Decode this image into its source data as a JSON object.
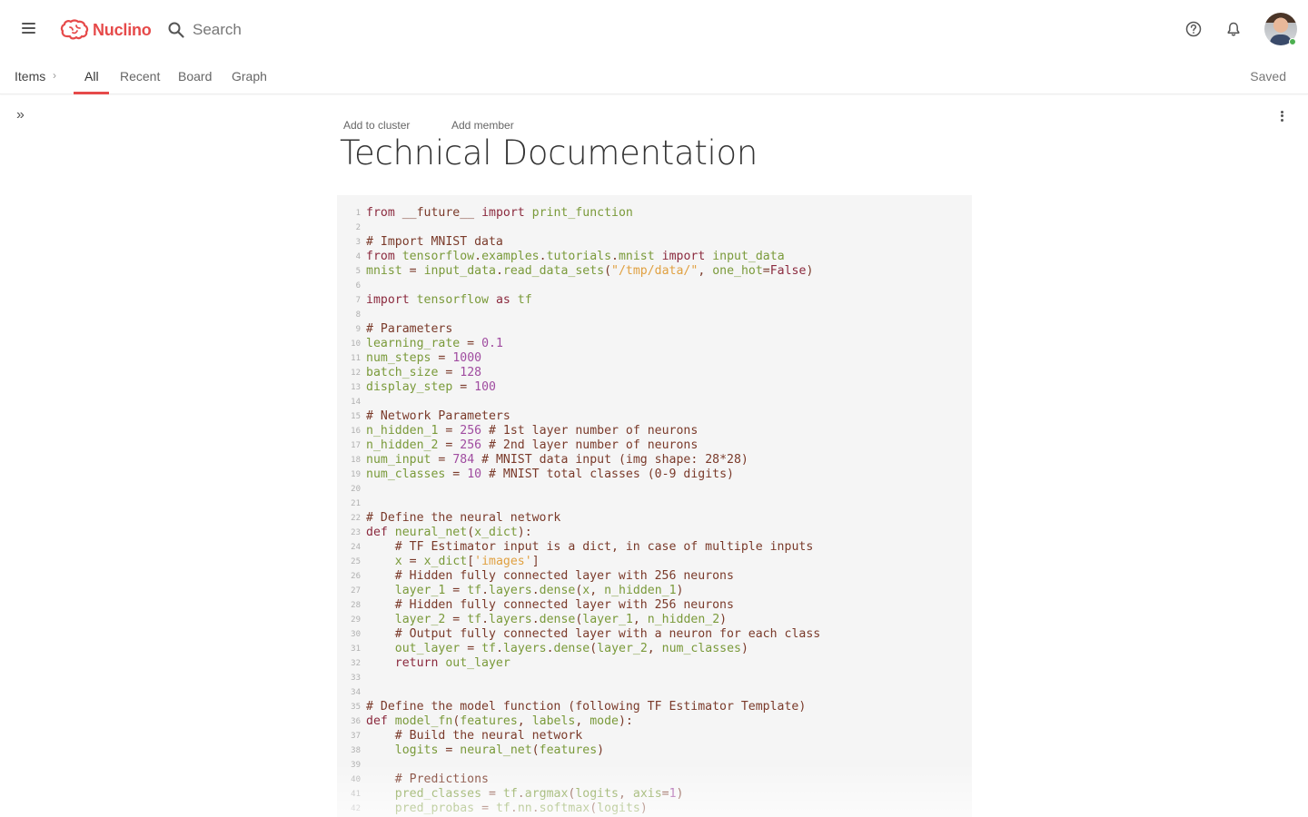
{
  "app": {
    "brand": "Nuclino",
    "brand_color": "#e64a4a"
  },
  "header": {
    "search_placeholder": "Search",
    "help_icon": "help-circle-icon",
    "notifications_icon": "bell-icon"
  },
  "nav": {
    "breadcrumb": "Items",
    "tabs": [
      {
        "label": "All",
        "active": true
      },
      {
        "label": "Recent",
        "active": false
      },
      {
        "label": "Board",
        "active": false
      },
      {
        "label": "Graph",
        "active": false
      }
    ],
    "status": "Saved"
  },
  "document": {
    "add_cluster": "Add to cluster",
    "add_member": "Add member",
    "title": "Technical Documentation"
  },
  "code": {
    "lines": [
      [
        [
          "k",
          "from"
        ],
        [
          "t",
          " "
        ],
        [
          "c",
          "__future__"
        ],
        [
          "t",
          " "
        ],
        [
          "k",
          "import"
        ],
        [
          "t",
          " "
        ],
        [
          "n",
          "print_function"
        ]
      ],
      [],
      [
        [
          "c",
          "# Import MNIST data"
        ]
      ],
      [
        [
          "k",
          "from"
        ],
        [
          "t",
          " "
        ],
        [
          "n",
          "tensorflow"
        ],
        [
          "c",
          "."
        ],
        [
          "n",
          "examples"
        ],
        [
          "c",
          "."
        ],
        [
          "n",
          "tutorials"
        ],
        [
          "c",
          "."
        ],
        [
          "n",
          "mnist"
        ],
        [
          "t",
          " "
        ],
        [
          "k",
          "import"
        ],
        [
          "t",
          " "
        ],
        [
          "n",
          "input_data"
        ]
      ],
      [
        [
          "n",
          "mnist"
        ],
        [
          "t",
          " "
        ],
        [
          "c",
          "="
        ],
        [
          "t",
          " "
        ],
        [
          "n",
          "input_data"
        ],
        [
          "c",
          "."
        ],
        [
          "n",
          "read_data_sets"
        ],
        [
          "c",
          "("
        ],
        [
          "s",
          "\"/tmp/data/\""
        ],
        [
          "c",
          ", "
        ],
        [
          "n",
          "one_hot"
        ],
        [
          "c",
          "="
        ],
        [
          "k",
          "False"
        ],
        [
          "c",
          ")"
        ]
      ],
      [],
      [
        [
          "k",
          "import"
        ],
        [
          "t",
          " "
        ],
        [
          "n",
          "tensorflow"
        ],
        [
          "t",
          " "
        ],
        [
          "k",
          "as"
        ],
        [
          "t",
          " "
        ],
        [
          "n",
          "tf"
        ]
      ],
      [],
      [
        [
          "c",
          "# Parameters"
        ]
      ],
      [
        [
          "n",
          "learning_rate"
        ],
        [
          "t",
          " "
        ],
        [
          "c",
          "="
        ],
        [
          "t",
          " "
        ],
        [
          "m",
          "0.1"
        ]
      ],
      [
        [
          "n",
          "num_steps"
        ],
        [
          "t",
          " "
        ],
        [
          "c",
          "="
        ],
        [
          "t",
          " "
        ],
        [
          "m",
          "1000"
        ]
      ],
      [
        [
          "n",
          "batch_size"
        ],
        [
          "t",
          " "
        ],
        [
          "c",
          "="
        ],
        [
          "t",
          " "
        ],
        [
          "m",
          "128"
        ]
      ],
      [
        [
          "n",
          "display_step"
        ],
        [
          "t",
          " "
        ],
        [
          "c",
          "="
        ],
        [
          "t",
          " "
        ],
        [
          "m",
          "100"
        ]
      ],
      [],
      [
        [
          "c",
          "# Network Parameters"
        ]
      ],
      [
        [
          "n",
          "n_hidden_1"
        ],
        [
          "t",
          " "
        ],
        [
          "c",
          "="
        ],
        [
          "t",
          " "
        ],
        [
          "m",
          "256"
        ],
        [
          "t",
          " "
        ],
        [
          "c",
          "# 1st layer number of neurons"
        ]
      ],
      [
        [
          "n",
          "n_hidden_2"
        ],
        [
          "t",
          " "
        ],
        [
          "c",
          "="
        ],
        [
          "t",
          " "
        ],
        [
          "m",
          "256"
        ],
        [
          "t",
          " "
        ],
        [
          "c",
          "# 2nd layer number of neurons"
        ]
      ],
      [
        [
          "n",
          "num_input"
        ],
        [
          "t",
          " "
        ],
        [
          "c",
          "="
        ],
        [
          "t",
          " "
        ],
        [
          "m",
          "784"
        ],
        [
          "t",
          " "
        ],
        [
          "c",
          "# MNIST data input (img shape: 28*28)"
        ]
      ],
      [
        [
          "n",
          "num_classes"
        ],
        [
          "t",
          " "
        ],
        [
          "c",
          "="
        ],
        [
          "t",
          " "
        ],
        [
          "m",
          "10"
        ],
        [
          "t",
          " "
        ],
        [
          "c",
          "# MNIST total classes (0-9 digits)"
        ]
      ],
      [],
      [],
      [
        [
          "c",
          "# Define the neural network"
        ]
      ],
      [
        [
          "k",
          "def"
        ],
        [
          "t",
          " "
        ],
        [
          "n",
          "neural_net"
        ],
        [
          "c",
          "("
        ],
        [
          "n",
          "x_dict"
        ],
        [
          "c",
          "):"
        ]
      ],
      [
        [
          "t",
          "    "
        ],
        [
          "c",
          "# TF Estimator input is a dict, in case of multiple inputs"
        ]
      ],
      [
        [
          "t",
          "    "
        ],
        [
          "n",
          "x"
        ],
        [
          "t",
          " "
        ],
        [
          "c",
          "="
        ],
        [
          "t",
          " "
        ],
        [
          "n",
          "x_dict"
        ],
        [
          "c",
          "["
        ],
        [
          "s",
          "'images'"
        ],
        [
          "c",
          "]"
        ]
      ],
      [
        [
          "t",
          "    "
        ],
        [
          "c",
          "# Hidden fully connected layer with 256 neurons"
        ]
      ],
      [
        [
          "t",
          "    "
        ],
        [
          "n",
          "layer_1"
        ],
        [
          "t",
          " "
        ],
        [
          "c",
          "="
        ],
        [
          "t",
          " "
        ],
        [
          "n",
          "tf"
        ],
        [
          "c",
          "."
        ],
        [
          "n",
          "layers"
        ],
        [
          "c",
          "."
        ],
        [
          "n",
          "dense"
        ],
        [
          "c",
          "("
        ],
        [
          "n",
          "x"
        ],
        [
          "c",
          ", "
        ],
        [
          "n",
          "n_hidden_1"
        ],
        [
          "c",
          ")"
        ]
      ],
      [
        [
          "t",
          "    "
        ],
        [
          "c",
          "# Hidden fully connected layer with 256 neurons"
        ]
      ],
      [
        [
          "t",
          "    "
        ],
        [
          "n",
          "layer_2"
        ],
        [
          "t",
          " "
        ],
        [
          "c",
          "="
        ],
        [
          "t",
          " "
        ],
        [
          "n",
          "tf"
        ],
        [
          "c",
          "."
        ],
        [
          "n",
          "layers"
        ],
        [
          "c",
          "."
        ],
        [
          "n",
          "dense"
        ],
        [
          "c",
          "("
        ],
        [
          "n",
          "layer_1"
        ],
        [
          "c",
          ", "
        ],
        [
          "n",
          "n_hidden_2"
        ],
        [
          "c",
          ")"
        ]
      ],
      [
        [
          "t",
          "    "
        ],
        [
          "c",
          "# Output fully connected layer with a neuron for each class"
        ]
      ],
      [
        [
          "t",
          "    "
        ],
        [
          "n",
          "out_layer"
        ],
        [
          "t",
          " "
        ],
        [
          "c",
          "="
        ],
        [
          "t",
          " "
        ],
        [
          "n",
          "tf"
        ],
        [
          "c",
          "."
        ],
        [
          "n",
          "layers"
        ],
        [
          "c",
          "."
        ],
        [
          "n",
          "dense"
        ],
        [
          "c",
          "("
        ],
        [
          "n",
          "layer_2"
        ],
        [
          "c",
          ", "
        ],
        [
          "n",
          "num_classes"
        ],
        [
          "c",
          ")"
        ]
      ],
      [
        [
          "t",
          "    "
        ],
        [
          "k",
          "return"
        ],
        [
          "t",
          " "
        ],
        [
          "n",
          "out_layer"
        ]
      ],
      [],
      [],
      [
        [
          "c",
          "# Define the model function (following TF Estimator Template)"
        ]
      ],
      [
        [
          "k",
          "def"
        ],
        [
          "t",
          " "
        ],
        [
          "n",
          "model_fn"
        ],
        [
          "c",
          "("
        ],
        [
          "n",
          "features"
        ],
        [
          "c",
          ", "
        ],
        [
          "n",
          "labels"
        ],
        [
          "c",
          ", "
        ],
        [
          "n",
          "mode"
        ],
        [
          "c",
          "):"
        ]
      ],
      [
        [
          "t",
          "    "
        ],
        [
          "c",
          "# Build the neural network"
        ]
      ],
      [
        [
          "t",
          "    "
        ],
        [
          "n",
          "logits"
        ],
        [
          "t",
          " "
        ],
        [
          "c",
          "="
        ],
        [
          "t",
          " "
        ],
        [
          "n",
          "neural_net"
        ],
        [
          "c",
          "("
        ],
        [
          "n",
          "features"
        ],
        [
          "c",
          ")"
        ]
      ],
      [],
      [
        [
          "t",
          "    "
        ],
        [
          "c",
          "# Predictions"
        ]
      ],
      [
        [
          "t",
          "    "
        ],
        [
          "n",
          "pred_classes"
        ],
        [
          "t",
          " "
        ],
        [
          "c",
          "="
        ],
        [
          "t",
          " "
        ],
        [
          "n",
          "tf"
        ],
        [
          "c",
          "."
        ],
        [
          "n",
          "argmax"
        ],
        [
          "c",
          "("
        ],
        [
          "n",
          "logits"
        ],
        [
          "c",
          ", "
        ],
        [
          "n",
          "axis"
        ],
        [
          "c",
          "="
        ],
        [
          "m",
          "1"
        ],
        [
          "c",
          ")"
        ]
      ],
      [
        [
          "t",
          "    "
        ],
        [
          "n",
          "pred_probas"
        ],
        [
          "t",
          " "
        ],
        [
          "c",
          "="
        ],
        [
          "t",
          " "
        ],
        [
          "n",
          "tf"
        ],
        [
          "c",
          "."
        ],
        [
          "n",
          "nn"
        ],
        [
          "c",
          "."
        ],
        [
          "n",
          "softmax"
        ],
        [
          "c",
          "("
        ],
        [
          "n",
          "logits"
        ],
        [
          "c",
          ")"
        ]
      ]
    ]
  }
}
